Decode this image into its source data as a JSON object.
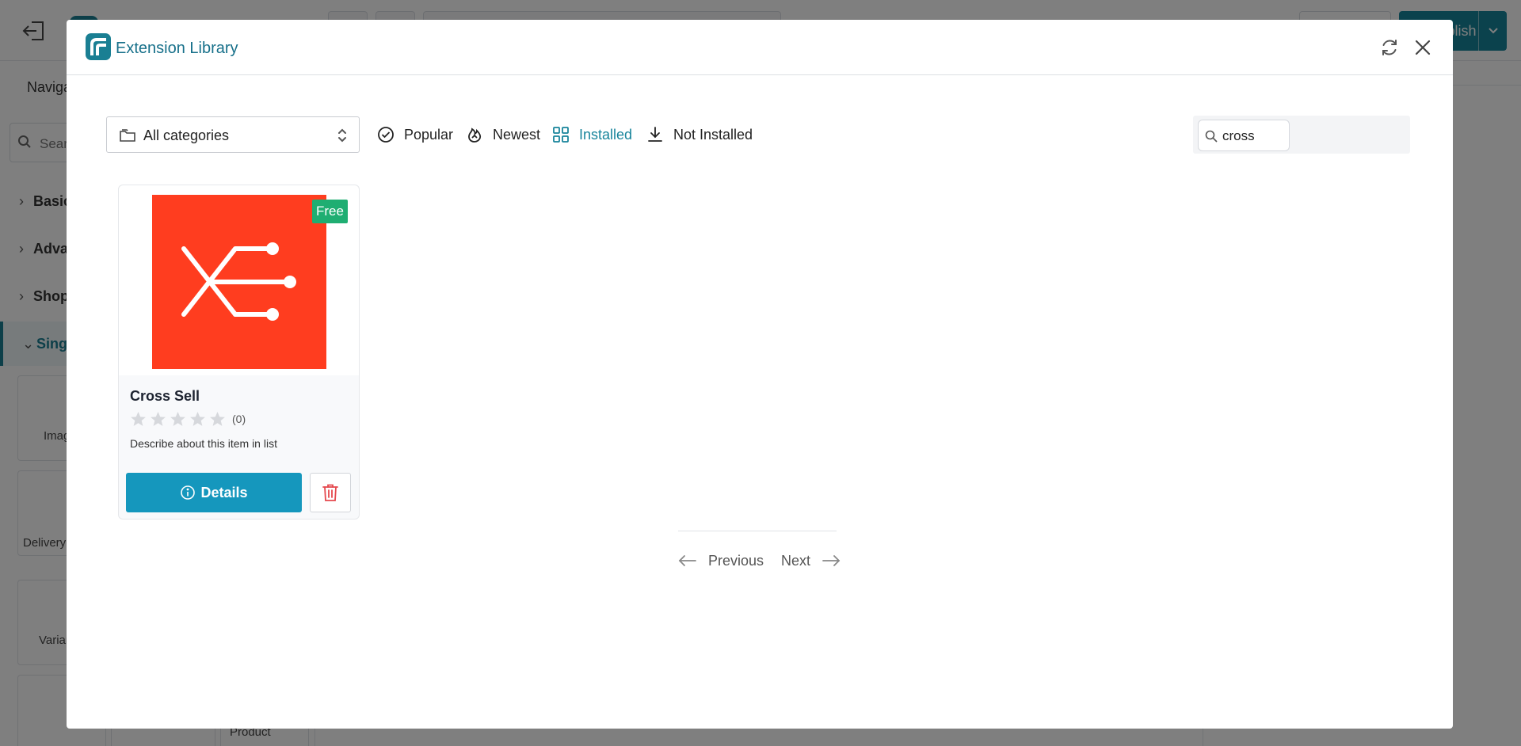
{
  "background": {
    "sidebar": {
      "nav_tab": "Navigator",
      "search_placeholder": "Search",
      "sections": [
        "Basic",
        "Advanced",
        "Shop",
        "Single"
      ],
      "tiles": [
        "Image",
        "Delivery",
        "Variant",
        "Product"
      ]
    },
    "publish_label": "Publish"
  },
  "modal": {
    "title": "Extension Library",
    "category_select": {
      "selected": "All categories"
    },
    "filters": {
      "popular": "Popular",
      "newest": "Newest",
      "installed": "Installed",
      "not_installed": "Not Installed",
      "active": "Installed"
    },
    "search": {
      "value": "cross"
    },
    "items": [
      {
        "name": "Cross Sell",
        "badge": "Free",
        "rating": 0,
        "rating_count": "(0)",
        "description": "Describe about this item in list",
        "details_label": "Details",
        "thumb_color": "#ff3d1f"
      }
    ],
    "pagination": {
      "prev_label": "Previous",
      "next_label": "Next"
    }
  },
  "colors": {
    "accent": "#17849b",
    "details_button": "#1597bd",
    "free_badge": "#1fae72",
    "delete_icon": "#e5484d"
  }
}
